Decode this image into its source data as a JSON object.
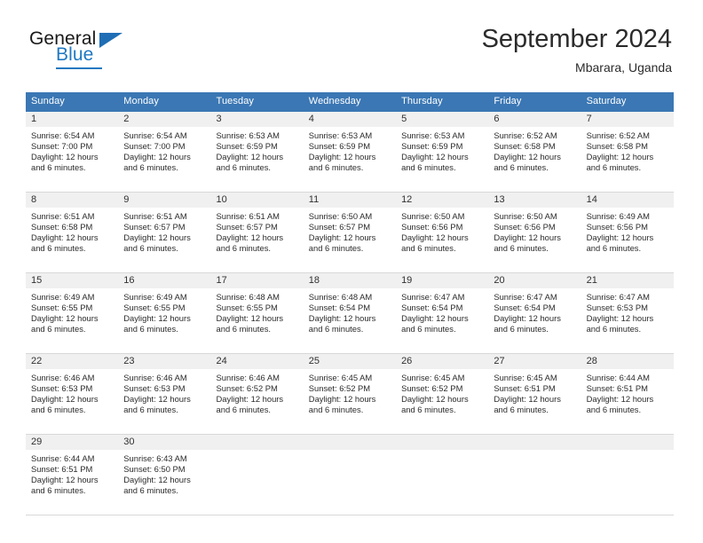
{
  "logo": {
    "word_one": "General",
    "word_two": "Blue",
    "triangle_color": "#1f6eb5",
    "blue_color": "#1f78c1"
  },
  "header": {
    "title": "September 2024",
    "subtitle": "Mbarara, Uganda",
    "header_bg": "#3b77b4",
    "daynum_bg": "#f0f0f0"
  },
  "weekdays": [
    "Sunday",
    "Monday",
    "Tuesday",
    "Wednesday",
    "Thursday",
    "Friday",
    "Saturday"
  ],
  "weeks": [
    [
      {
        "day": "1",
        "sunrise": "Sunrise: 6:54 AM",
        "sunset": "Sunset: 7:00 PM",
        "daylight1": "Daylight: 12 hours",
        "daylight2": "and 6 minutes."
      },
      {
        "day": "2",
        "sunrise": "Sunrise: 6:54 AM",
        "sunset": "Sunset: 7:00 PM",
        "daylight1": "Daylight: 12 hours",
        "daylight2": "and 6 minutes."
      },
      {
        "day": "3",
        "sunrise": "Sunrise: 6:53 AM",
        "sunset": "Sunset: 6:59 PM",
        "daylight1": "Daylight: 12 hours",
        "daylight2": "and 6 minutes."
      },
      {
        "day": "4",
        "sunrise": "Sunrise: 6:53 AM",
        "sunset": "Sunset: 6:59 PM",
        "daylight1": "Daylight: 12 hours",
        "daylight2": "and 6 minutes."
      },
      {
        "day": "5",
        "sunrise": "Sunrise: 6:53 AM",
        "sunset": "Sunset: 6:59 PM",
        "daylight1": "Daylight: 12 hours",
        "daylight2": "and 6 minutes."
      },
      {
        "day": "6",
        "sunrise": "Sunrise: 6:52 AM",
        "sunset": "Sunset: 6:58 PM",
        "daylight1": "Daylight: 12 hours",
        "daylight2": "and 6 minutes."
      },
      {
        "day": "7",
        "sunrise": "Sunrise: 6:52 AM",
        "sunset": "Sunset: 6:58 PM",
        "daylight1": "Daylight: 12 hours",
        "daylight2": "and 6 minutes."
      }
    ],
    [
      {
        "day": "8",
        "sunrise": "Sunrise: 6:51 AM",
        "sunset": "Sunset: 6:58 PM",
        "daylight1": "Daylight: 12 hours",
        "daylight2": "and 6 minutes."
      },
      {
        "day": "9",
        "sunrise": "Sunrise: 6:51 AM",
        "sunset": "Sunset: 6:57 PM",
        "daylight1": "Daylight: 12 hours",
        "daylight2": "and 6 minutes."
      },
      {
        "day": "10",
        "sunrise": "Sunrise: 6:51 AM",
        "sunset": "Sunset: 6:57 PM",
        "daylight1": "Daylight: 12 hours",
        "daylight2": "and 6 minutes."
      },
      {
        "day": "11",
        "sunrise": "Sunrise: 6:50 AM",
        "sunset": "Sunset: 6:57 PM",
        "daylight1": "Daylight: 12 hours",
        "daylight2": "and 6 minutes."
      },
      {
        "day": "12",
        "sunrise": "Sunrise: 6:50 AM",
        "sunset": "Sunset: 6:56 PM",
        "daylight1": "Daylight: 12 hours",
        "daylight2": "and 6 minutes."
      },
      {
        "day": "13",
        "sunrise": "Sunrise: 6:50 AM",
        "sunset": "Sunset: 6:56 PM",
        "daylight1": "Daylight: 12 hours",
        "daylight2": "and 6 minutes."
      },
      {
        "day": "14",
        "sunrise": "Sunrise: 6:49 AM",
        "sunset": "Sunset: 6:56 PM",
        "daylight1": "Daylight: 12 hours",
        "daylight2": "and 6 minutes."
      }
    ],
    [
      {
        "day": "15",
        "sunrise": "Sunrise: 6:49 AM",
        "sunset": "Sunset: 6:55 PM",
        "daylight1": "Daylight: 12 hours",
        "daylight2": "and 6 minutes."
      },
      {
        "day": "16",
        "sunrise": "Sunrise: 6:49 AM",
        "sunset": "Sunset: 6:55 PM",
        "daylight1": "Daylight: 12 hours",
        "daylight2": "and 6 minutes."
      },
      {
        "day": "17",
        "sunrise": "Sunrise: 6:48 AM",
        "sunset": "Sunset: 6:55 PM",
        "daylight1": "Daylight: 12 hours",
        "daylight2": "and 6 minutes."
      },
      {
        "day": "18",
        "sunrise": "Sunrise: 6:48 AM",
        "sunset": "Sunset: 6:54 PM",
        "daylight1": "Daylight: 12 hours",
        "daylight2": "and 6 minutes."
      },
      {
        "day": "19",
        "sunrise": "Sunrise: 6:47 AM",
        "sunset": "Sunset: 6:54 PM",
        "daylight1": "Daylight: 12 hours",
        "daylight2": "and 6 minutes."
      },
      {
        "day": "20",
        "sunrise": "Sunrise: 6:47 AM",
        "sunset": "Sunset: 6:54 PM",
        "daylight1": "Daylight: 12 hours",
        "daylight2": "and 6 minutes."
      },
      {
        "day": "21",
        "sunrise": "Sunrise: 6:47 AM",
        "sunset": "Sunset: 6:53 PM",
        "daylight1": "Daylight: 12 hours",
        "daylight2": "and 6 minutes."
      }
    ],
    [
      {
        "day": "22",
        "sunrise": "Sunrise: 6:46 AM",
        "sunset": "Sunset: 6:53 PM",
        "daylight1": "Daylight: 12 hours",
        "daylight2": "and 6 minutes."
      },
      {
        "day": "23",
        "sunrise": "Sunrise: 6:46 AM",
        "sunset": "Sunset: 6:53 PM",
        "daylight1": "Daylight: 12 hours",
        "daylight2": "and 6 minutes."
      },
      {
        "day": "24",
        "sunrise": "Sunrise: 6:46 AM",
        "sunset": "Sunset: 6:52 PM",
        "daylight1": "Daylight: 12 hours",
        "daylight2": "and 6 minutes."
      },
      {
        "day": "25",
        "sunrise": "Sunrise: 6:45 AM",
        "sunset": "Sunset: 6:52 PM",
        "daylight1": "Daylight: 12 hours",
        "daylight2": "and 6 minutes."
      },
      {
        "day": "26",
        "sunrise": "Sunrise: 6:45 AM",
        "sunset": "Sunset: 6:52 PM",
        "daylight1": "Daylight: 12 hours",
        "daylight2": "and 6 minutes."
      },
      {
        "day": "27",
        "sunrise": "Sunrise: 6:45 AM",
        "sunset": "Sunset: 6:51 PM",
        "daylight1": "Daylight: 12 hours",
        "daylight2": "and 6 minutes."
      },
      {
        "day": "28",
        "sunrise": "Sunrise: 6:44 AM",
        "sunset": "Sunset: 6:51 PM",
        "daylight1": "Daylight: 12 hours",
        "daylight2": "and 6 minutes."
      }
    ],
    [
      {
        "day": "29",
        "sunrise": "Sunrise: 6:44 AM",
        "sunset": "Sunset: 6:51 PM",
        "daylight1": "Daylight: 12 hours",
        "daylight2": "and 6 minutes."
      },
      {
        "day": "30",
        "sunrise": "Sunrise: 6:43 AM",
        "sunset": "Sunset: 6:50 PM",
        "daylight1": "Daylight: 12 hours",
        "daylight2": "and 6 minutes."
      },
      {
        "day": "",
        "sunrise": "",
        "sunset": "",
        "daylight1": "",
        "daylight2": ""
      },
      {
        "day": "",
        "sunrise": "",
        "sunset": "",
        "daylight1": "",
        "daylight2": ""
      },
      {
        "day": "",
        "sunrise": "",
        "sunset": "",
        "daylight1": "",
        "daylight2": ""
      },
      {
        "day": "",
        "sunrise": "",
        "sunset": "",
        "daylight1": "",
        "daylight2": ""
      },
      {
        "day": "",
        "sunrise": "",
        "sunset": "",
        "daylight1": "",
        "daylight2": ""
      }
    ]
  ]
}
